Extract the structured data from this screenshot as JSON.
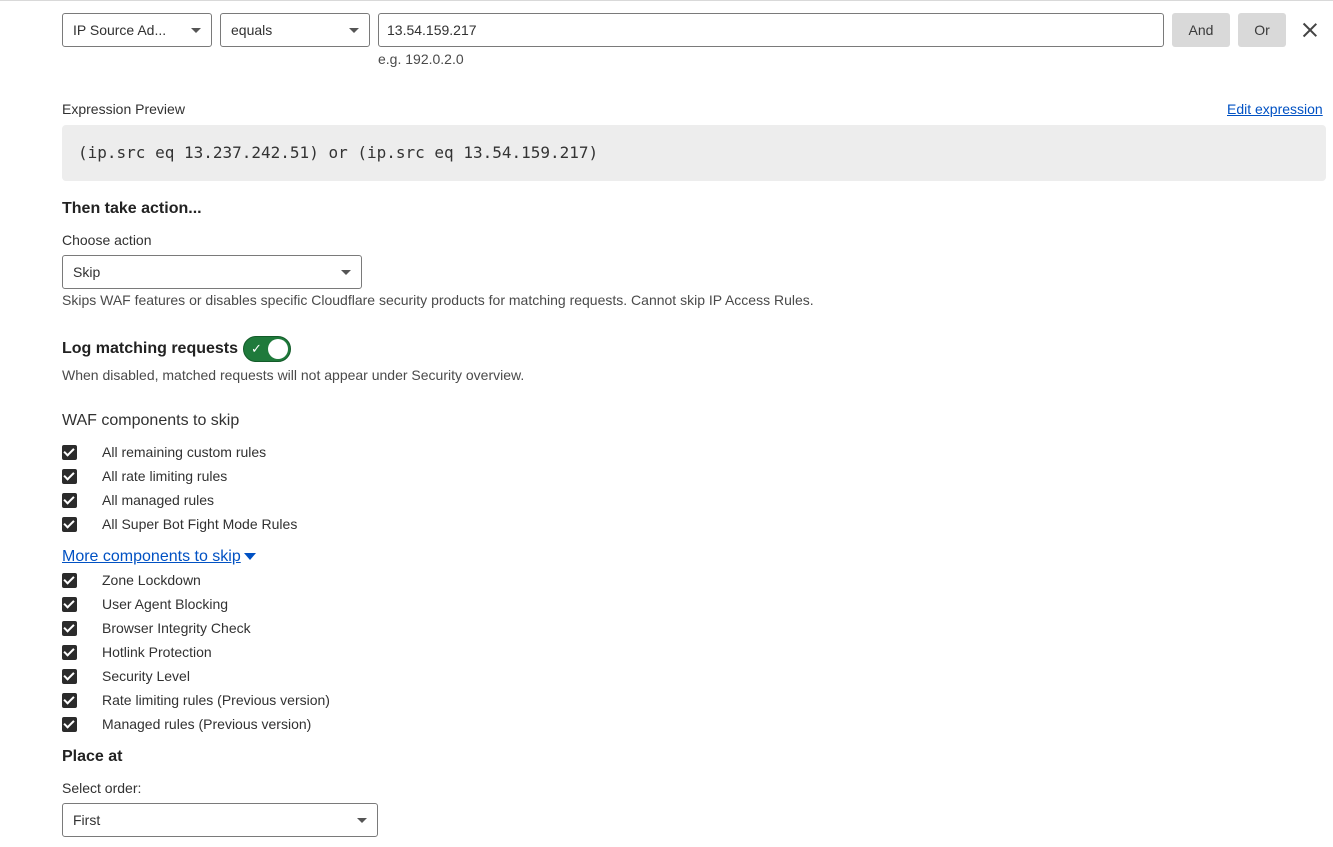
{
  "expression_row": {
    "field_select": "IP Source Ad...",
    "operator_select": "equals",
    "value_input": "13.54.159.217",
    "value_hint": "e.g. 192.0.2.0",
    "and_label": "And",
    "or_label": "Or",
    "remove_icon": "close-icon"
  },
  "preview": {
    "label": "Expression Preview",
    "edit_link": "Edit expression",
    "expression": "(ip.src eq 13.237.242.51) or (ip.src eq 13.54.159.217)"
  },
  "action": {
    "heading": "Then take action...",
    "choose_label": "Choose action",
    "selected": "Skip",
    "description": "Skips WAF features or disables specific Cloudflare security products for matching requests. Cannot skip IP Access Rules."
  },
  "logging": {
    "label": "Log matching requests",
    "enabled": true,
    "description": "When disabled, matched requests will not appear under Security overview."
  },
  "waf": {
    "heading": "WAF components to skip",
    "items": [
      {
        "label": "All remaining custom rules",
        "checked": true
      },
      {
        "label": "All rate limiting rules",
        "checked": true
      },
      {
        "label": "All managed rules",
        "checked": true
      },
      {
        "label": "All Super Bot Fight Mode Rules",
        "checked": true
      }
    ],
    "more_link": "More components to skip",
    "more_items": [
      {
        "label": "Zone Lockdown",
        "checked": true
      },
      {
        "label": "User Agent Blocking",
        "checked": true
      },
      {
        "label": "Browser Integrity Check",
        "checked": true
      },
      {
        "label": "Hotlink Protection",
        "checked": true
      },
      {
        "label": "Security Level",
        "checked": true
      },
      {
        "label": "Rate limiting rules (Previous version)",
        "checked": true
      },
      {
        "label": "Managed rules (Previous version)",
        "checked": true
      }
    ]
  },
  "place": {
    "heading": "Place at",
    "order_label": "Select order:",
    "selected": "First"
  },
  "colors": {
    "link": "#0051c3",
    "toggle_on": "#1f7a3b",
    "preview_bg": "#ededed"
  }
}
